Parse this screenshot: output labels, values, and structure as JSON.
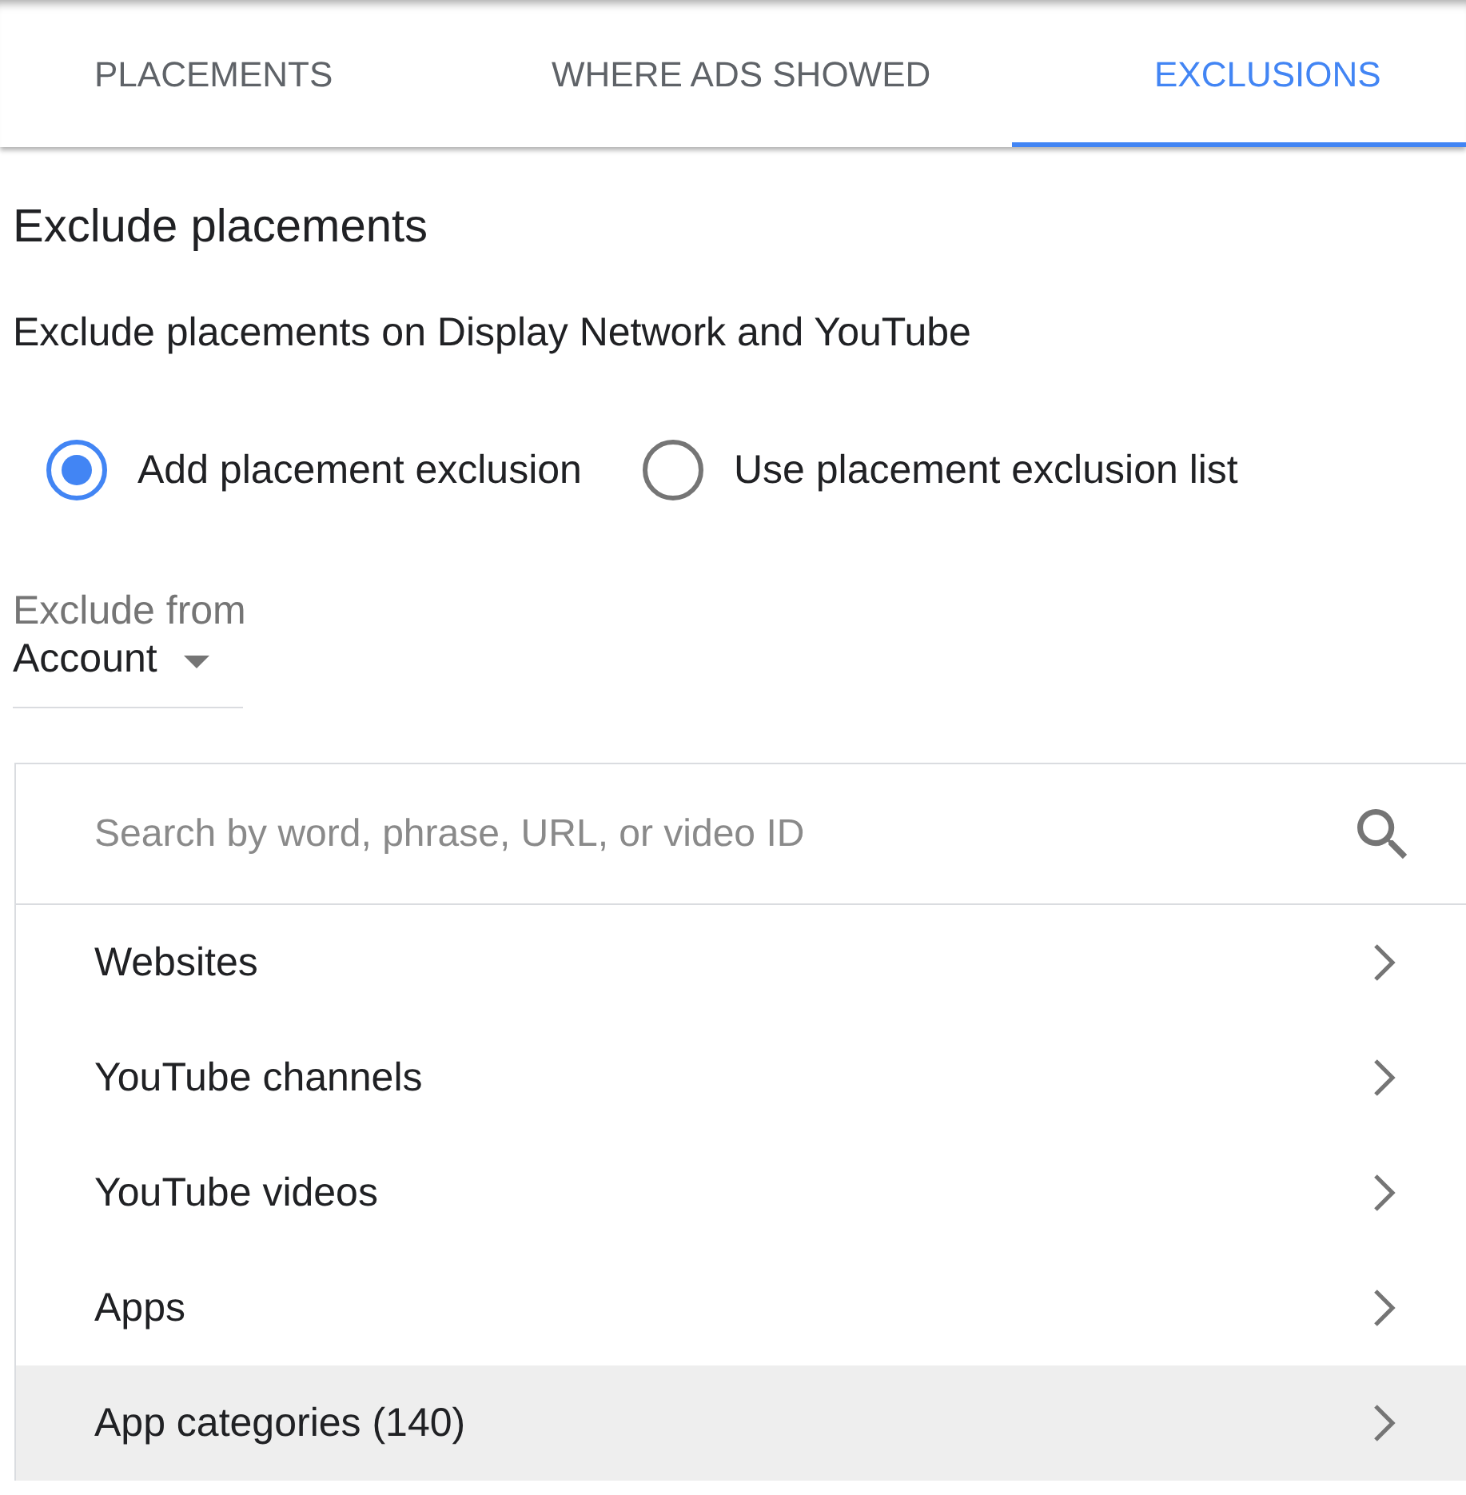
{
  "tabs": [
    {
      "label": "PLACEMENTS",
      "selected": false
    },
    {
      "label": "WHERE ADS SHOWED",
      "selected": false
    },
    {
      "label": "EXCLUSIONS",
      "selected": true
    }
  ],
  "section": {
    "title": "Exclude placements",
    "subtitle": "Exclude placements on Display Network and YouTube"
  },
  "radio_options": [
    {
      "label": "Add placement exclusion",
      "selected": true
    },
    {
      "label": "Use placement exclusion list",
      "selected": false
    }
  ],
  "exclude_from": {
    "label": "Exclude from",
    "value": "Account"
  },
  "search": {
    "placeholder": "Search by word, phrase, URL, or video ID"
  },
  "categories": [
    {
      "label": "Websites",
      "selected": false
    },
    {
      "label": "YouTube channels",
      "selected": false
    },
    {
      "label": "YouTube videos",
      "selected": false
    },
    {
      "label": "Apps",
      "selected": false
    },
    {
      "label": "App categories (140)",
      "selected": true
    }
  ]
}
